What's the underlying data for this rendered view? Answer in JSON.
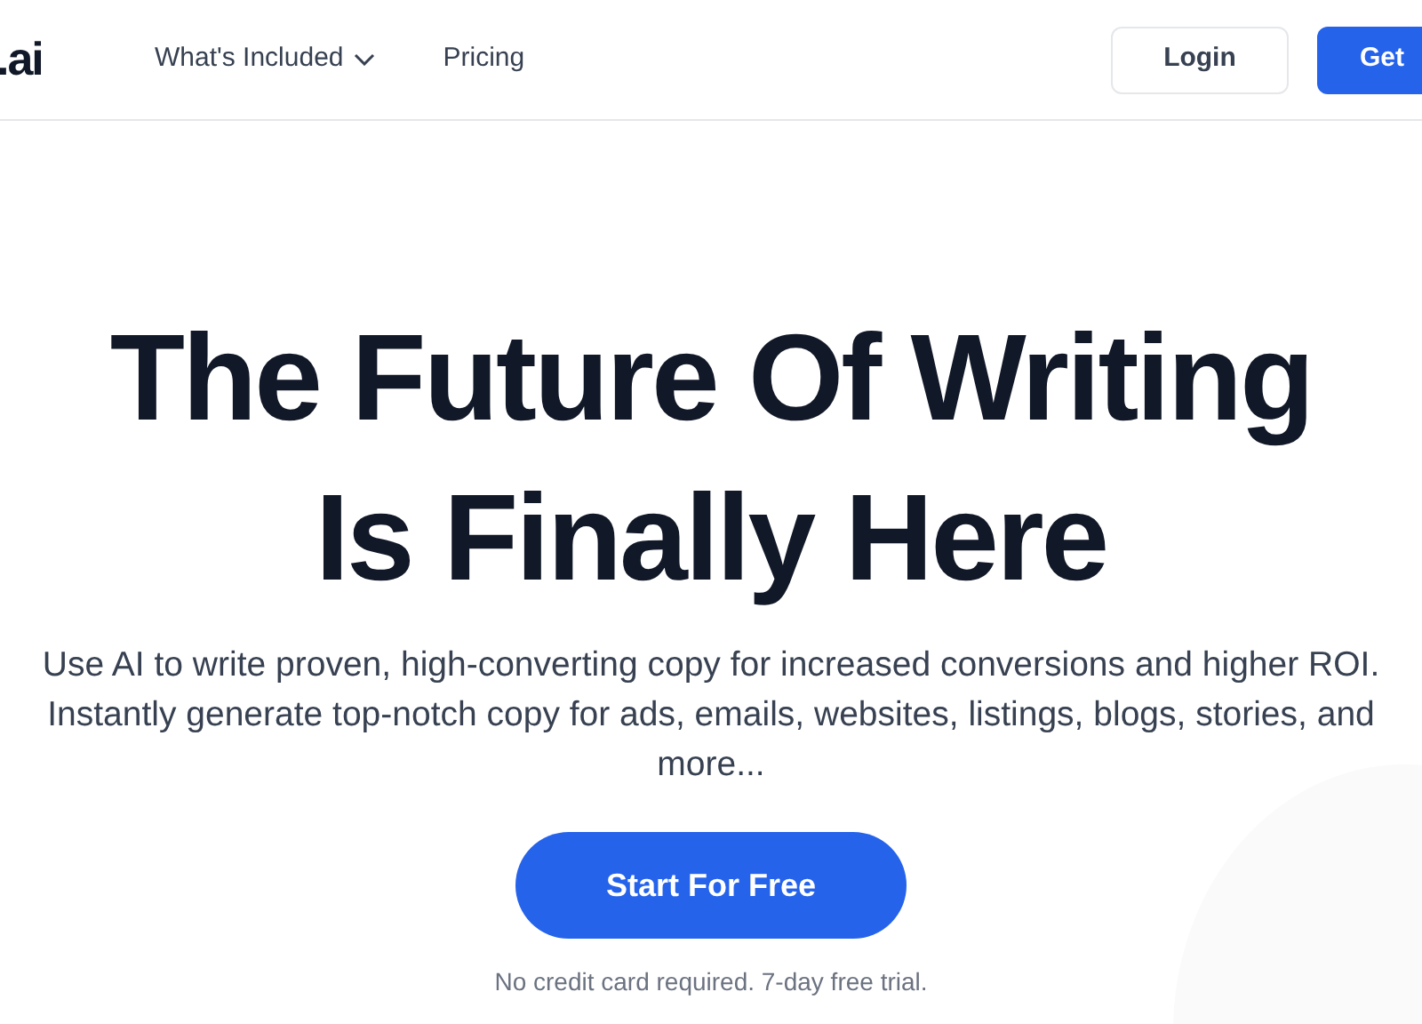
{
  "header": {
    "logo": ".ai",
    "nav": [
      {
        "label": "What's Included",
        "kind": "dropdown"
      },
      {
        "label": "Pricing",
        "kind": "link"
      }
    ],
    "login_button": "Login",
    "signup_button": "Get"
  },
  "hero": {
    "title_lines": [
      "The Future Of Writing",
      "Is Finally Here"
    ],
    "description": "Use AI to write proven, high-converting copy for increased conversions and higher ROI. Instantly generate top-notch copy for ads, emails, websites, listings, blogs, stories, and more...",
    "cta": "Start For Free",
    "note": "No credit card required. 7-day free trial."
  }
}
